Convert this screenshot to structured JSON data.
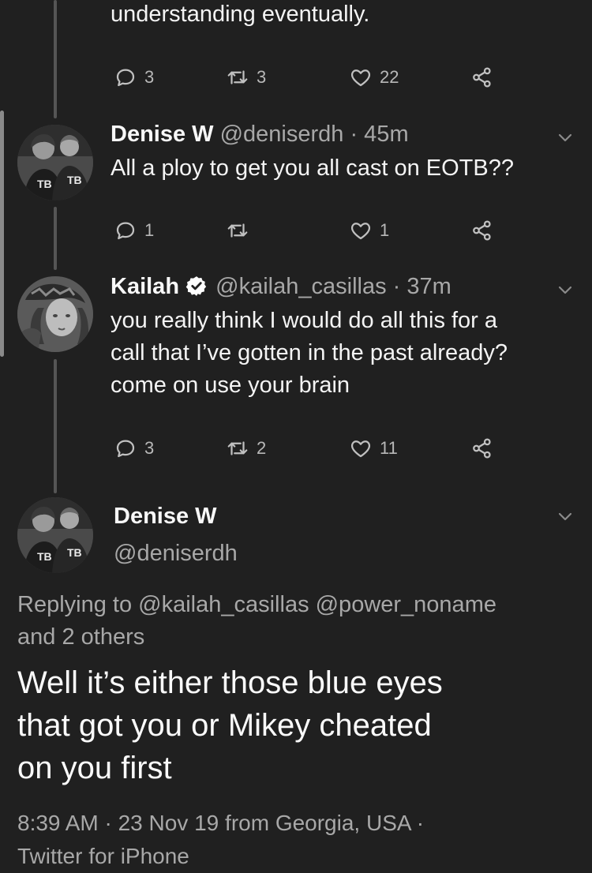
{
  "top_tweet": {
    "text_tail": "understanding eventually.",
    "replies": "3",
    "retweets": "3",
    "likes": "22"
  },
  "reply1": {
    "name": "Denise W",
    "handle": "@deniserdh",
    "time": "· 45m",
    "text": "All a ploy to get you all cast on EOTB??",
    "replies": "1",
    "retweets": "",
    "likes": "1"
  },
  "reply2": {
    "name": "Kailah",
    "handle": "@kailah_casillas",
    "time": "· 37m",
    "text_lines": [
      "you really think I would do all this for a",
      "call that I’ve gotten in the past already?",
      "come on use your brain"
    ],
    "replies": "3",
    "retweets": "2",
    "likes": "11"
  },
  "main_tweet": {
    "name": "Denise W",
    "handle": "@deniserdh",
    "replying_line1": "Replying to @kailah_casillas @power_noname",
    "replying_line2": "and 2 others",
    "text_lines": [
      "Well it’s either those blue eyes",
      "that got you or Mikey cheated",
      "on you first"
    ],
    "meta_line1": "8:39 AM · 23 Nov 19 from Georgia, USA ·",
    "meta_line2": "Twitter for iPhone"
  },
  "colors": {
    "background": "#202020",
    "text": "#f2f2f2",
    "secondary": "#a8a8a8",
    "verified": "#ffffff"
  },
  "icons": [
    "reply-icon",
    "retweet-icon",
    "like-icon",
    "share-icon",
    "chevron-down-icon",
    "verified-icon"
  ]
}
